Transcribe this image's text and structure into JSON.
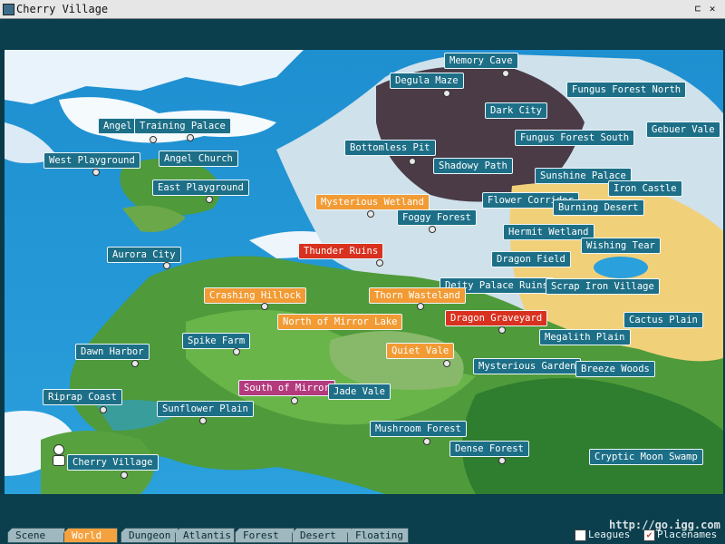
{
  "window": {
    "title": "Cherry Village"
  },
  "tabs": [
    {
      "label": "Scene",
      "active": false
    },
    {
      "label": "World",
      "active": true
    },
    {
      "label": "Dungeon",
      "active": false
    },
    {
      "label": "Atlantis",
      "active": false
    },
    {
      "label": "Forest",
      "active": false
    },
    {
      "label": "Desert",
      "active": false
    },
    {
      "label": "Floating",
      "active": false
    }
  ],
  "toggles": {
    "leagues": "Leagues",
    "placenames": "Placenames"
  },
  "watermark": "http://go.igg.com",
  "places": [
    {
      "name": "Memory Cave",
      "style": "blue"
    },
    {
      "name": "Degula Maze",
      "style": "blue"
    },
    {
      "name": "Fungus Forest North",
      "style": "blue"
    },
    {
      "name": "Dark City",
      "style": "blue"
    },
    {
      "name": "Angel Village",
      "style": "blue"
    },
    {
      "name": "Training Palace",
      "style": "blue"
    },
    {
      "name": "Fungus Forest South",
      "style": "blue"
    },
    {
      "name": "Gebuer Vale",
      "style": "blue"
    },
    {
      "name": "Bottomless Pit",
      "style": "blue"
    },
    {
      "name": "West Playground",
      "style": "blue"
    },
    {
      "name": "Angel Church",
      "style": "blue"
    },
    {
      "name": "Shadowy Path",
      "style": "blue"
    },
    {
      "name": "Sunshine Palace",
      "style": "blue"
    },
    {
      "name": "East Playground",
      "style": "blue"
    },
    {
      "name": "Iron Castle",
      "style": "blue"
    },
    {
      "name": "Mysterious Wetland",
      "style": "orange"
    },
    {
      "name": "Flower Corridor",
      "style": "blue"
    },
    {
      "name": "Burning Desert",
      "style": "blue"
    },
    {
      "name": "Foggy Forest",
      "style": "blue"
    },
    {
      "name": "Hermit Wetland",
      "style": "blue"
    },
    {
      "name": "Wishing Tear",
      "style": "blue"
    },
    {
      "name": "Thunder Ruins",
      "style": "red"
    },
    {
      "name": "Aurora City",
      "style": "blue"
    },
    {
      "name": "Dragon Field",
      "style": "blue"
    },
    {
      "name": "Deity Palace Ruins",
      "style": "blue"
    },
    {
      "name": "Scrap Iron Village",
      "style": "blue"
    },
    {
      "name": "Crashing Hillock",
      "style": "orange"
    },
    {
      "name": "Thorn Wasteland",
      "style": "orange"
    },
    {
      "name": "Dragon Graveyard",
      "style": "red"
    },
    {
      "name": "Cactus Plain",
      "style": "blue"
    },
    {
      "name": "North of Mirror Lake",
      "style": "orange"
    },
    {
      "name": "Megalith Plain",
      "style": "blue"
    },
    {
      "name": "Spike Farm",
      "style": "blue"
    },
    {
      "name": "Dawn Harbor",
      "style": "blue"
    },
    {
      "name": "Quiet Vale",
      "style": "orange"
    },
    {
      "name": "Mysterious Garden",
      "style": "blue"
    },
    {
      "name": "Breeze Woods",
      "style": "blue"
    },
    {
      "name": "South of Mirror",
      "style": "pink"
    },
    {
      "name": "Jade Vale",
      "style": "blue"
    },
    {
      "name": "Riprap Coast",
      "style": "blue"
    },
    {
      "name": "Sunflower Plain",
      "style": "blue"
    },
    {
      "name": "Mushroom Forest",
      "style": "blue"
    },
    {
      "name": "Dense Forest",
      "style": "blue"
    },
    {
      "name": "Cryptic Moon Swamp",
      "style": "blue"
    },
    {
      "name": "Cherry Village",
      "style": "blue"
    }
  ]
}
